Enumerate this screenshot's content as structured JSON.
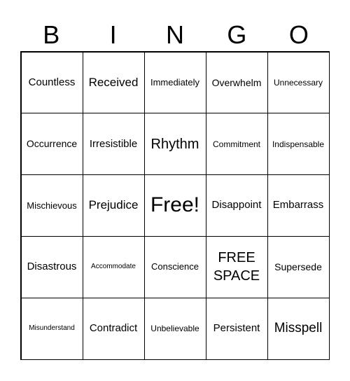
{
  "header": [
    "B",
    "I",
    "N",
    "G",
    "O"
  ],
  "cells": [
    "Countless",
    "Received",
    "Immediately",
    "Overwhelm",
    "Unnecessary",
    "Occurrence",
    "Irresistible",
    "Rhythm",
    "Commitment",
    "Indispensable",
    "Mischievous",
    "Prejudice",
    "Free!",
    "Disappoint",
    "Embarrass",
    "Disastrous",
    "Accommodate",
    "Conscience",
    "FREE SPACE",
    "Supersede",
    "Misunderstand",
    "Contradict",
    "Unbelievable",
    "Persistent",
    "Misspell"
  ]
}
